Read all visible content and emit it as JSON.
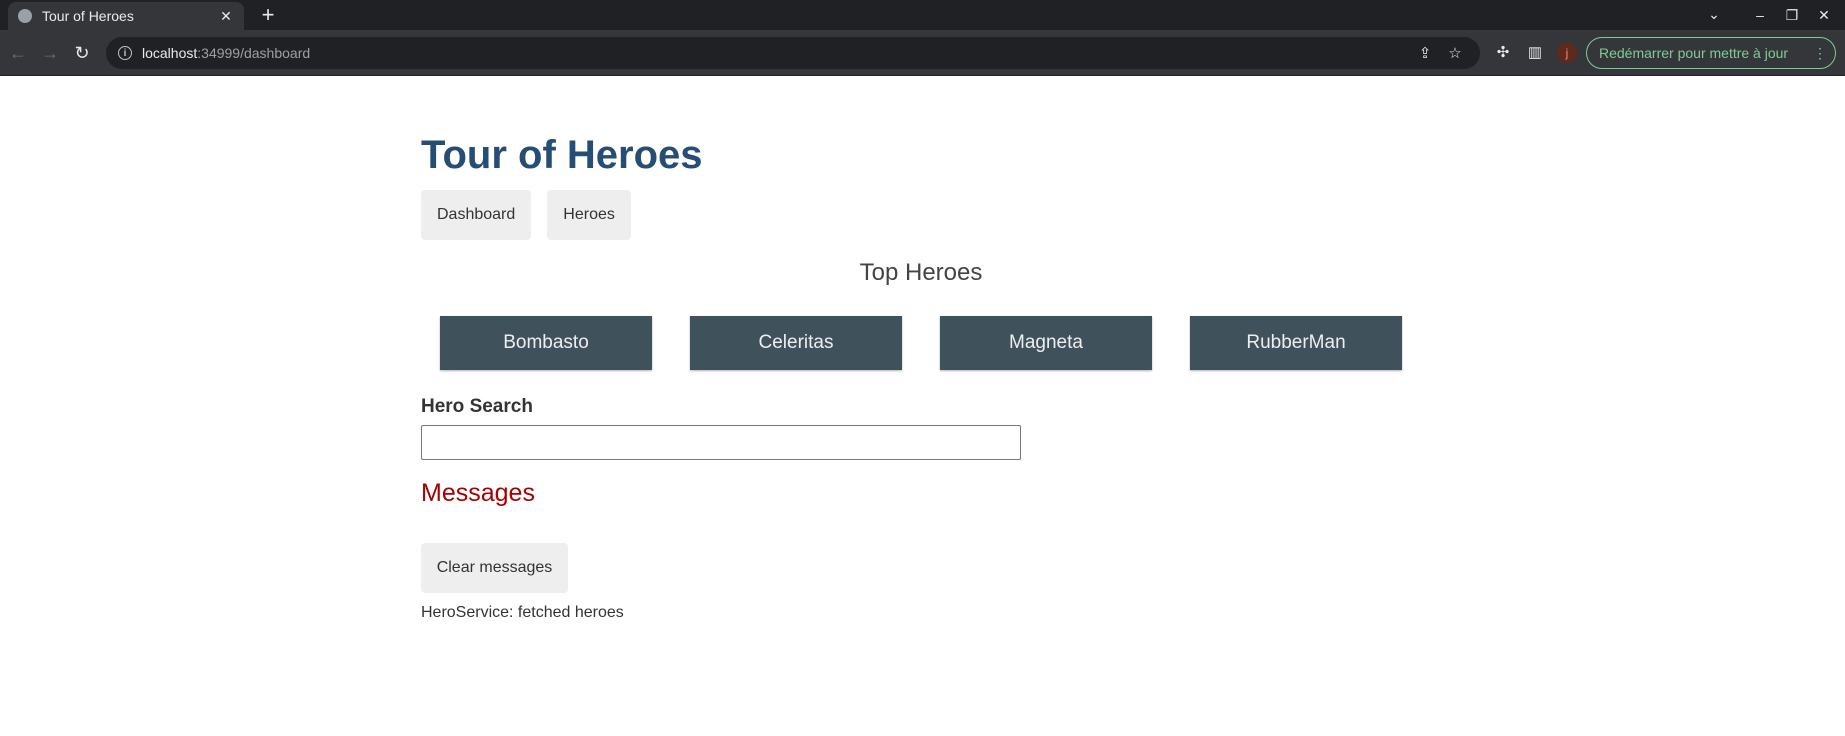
{
  "browser": {
    "tab_title": "Tour of Heroes",
    "tab_close": "✕",
    "new_tab": "+",
    "url_host": "localhost",
    "url_rest": ":34999/dashboard",
    "update_button": "Redémarrer pour mettre à jour",
    "avatar_initial": "j"
  },
  "app": {
    "title": "Tour of Heroes",
    "nav": [
      {
        "label": "Dashboard"
      },
      {
        "label": "Heroes"
      }
    ]
  },
  "dashboard": {
    "heading": "Top Heroes",
    "heroes": [
      {
        "name": "Bombasto"
      },
      {
        "name": "Celeritas"
      },
      {
        "name": "Magneta"
      },
      {
        "name": "RubberMan"
      }
    ]
  },
  "search": {
    "label": "Hero Search",
    "value": ""
  },
  "messages": {
    "heading": "Messages",
    "clear_label": "Clear messages",
    "items": [
      "HeroService: fetched heroes"
    ]
  },
  "colors": {
    "title": "#264d73",
    "hero_card": "#3f525c",
    "messages_heading": "#a80000",
    "update_accent": "#81c995"
  }
}
